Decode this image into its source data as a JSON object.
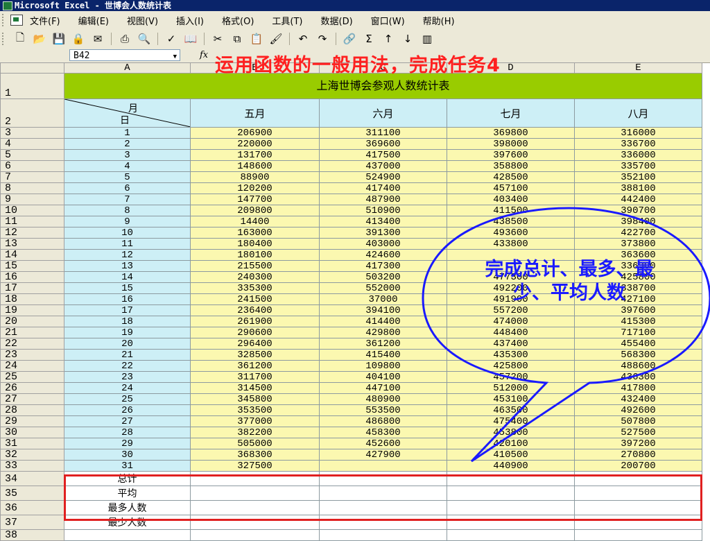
{
  "window": {
    "title": "Microsoft Excel - 世博会人数统计表"
  },
  "menu": {
    "items": [
      "文件(F)",
      "编辑(E)",
      "视图(V)",
      "插入(I)",
      "格式(O)",
      "工具(T)",
      "数据(D)",
      "窗口(W)",
      "帮助(H)"
    ]
  },
  "toolbar": {
    "sum_glyph": "Σ"
  },
  "formula_bar": {
    "name_box": "B42",
    "fx_label": "fx"
  },
  "overlay": {
    "headline": "运用函数的一般用法，完成任务4",
    "callout": "完成总计、最多、最少、平均人数"
  },
  "sheet": {
    "col_headers": [
      "A",
      "B",
      "C",
      "D",
      "E"
    ],
    "title": "上海世博会参观人数统计表",
    "corner_top": "月",
    "corner_bottom": "日",
    "month_headers": [
      "五月",
      "六月",
      "七月",
      "八月"
    ],
    "rows": [
      {
        "rn": "3",
        "day": "1",
        "v": [
          "206900",
          "311100",
          "369800",
          "316000"
        ]
      },
      {
        "rn": "4",
        "day": "2",
        "v": [
          "220000",
          "369600",
          "398000",
          "336700"
        ]
      },
      {
        "rn": "5",
        "day": "3",
        "v": [
          "131700",
          "417500",
          "397600",
          "336000"
        ]
      },
      {
        "rn": "6",
        "day": "4",
        "v": [
          "148600",
          "437000",
          "358800",
          "335700"
        ]
      },
      {
        "rn": "7",
        "day": "5",
        "v": [
          "88900",
          "524900",
          "428500",
          "352100"
        ]
      },
      {
        "rn": "8",
        "day": "6",
        "v": [
          "120200",
          "417400",
          "457100",
          "388100"
        ]
      },
      {
        "rn": "9",
        "day": "7",
        "v": [
          "147700",
          "487900",
          "403400",
          "442400"
        ]
      },
      {
        "rn": "10",
        "day": "8",
        "v": [
          "209800",
          "510900",
          "411500",
          "390700"
        ]
      },
      {
        "rn": "11",
        "day": "9",
        "v": [
          "14400",
          "413400",
          "438500",
          "398400"
        ]
      },
      {
        "rn": "12",
        "day": "10",
        "v": [
          "163000",
          "391300",
          "493600",
          "422700"
        ]
      },
      {
        "rn": "13",
        "day": "11",
        "v": [
          "180400",
          "403000",
          "433800",
          "373800"
        ]
      },
      {
        "rn": "14",
        "day": "12",
        "v": [
          "180100",
          "424600",
          "",
          "363600"
        ]
      },
      {
        "rn": "15",
        "day": "13",
        "v": [
          "215500",
          "417300",
          "",
          "336300"
        ]
      },
      {
        "rn": "16",
        "day": "14",
        "v": [
          "240300",
          "503200",
          "477300",
          "425800"
        ]
      },
      {
        "rn": "17",
        "day": "15",
        "v": [
          "335300",
          "552000",
          "492200",
          "338700"
        ]
      },
      {
        "rn": "18",
        "day": "16",
        "v": [
          "241500",
          "37000",
          "491900",
          "427100"
        ]
      },
      {
        "rn": "19",
        "day": "17",
        "v": [
          "236400",
          "394100",
          "557200",
          "397600"
        ]
      },
      {
        "rn": "20",
        "day": "18",
        "v": [
          "261900",
          "414400",
          "474000",
          "415300"
        ]
      },
      {
        "rn": "21",
        "day": "19",
        "v": [
          "290600",
          "429800",
          "448400",
          "717100"
        ]
      },
      {
        "rn": "22",
        "day": "20",
        "v": [
          "296400",
          "361200",
          "437400",
          "455400"
        ]
      },
      {
        "rn": "23",
        "day": "21",
        "v": [
          "328500",
          "415400",
          "435300",
          "568300"
        ]
      },
      {
        "rn": "24",
        "day": "22",
        "v": [
          "361200",
          "109800",
          "425800",
          "488600"
        ]
      },
      {
        "rn": "25",
        "day": "23",
        "v": [
          "311700",
          "404100",
          "457200",
          "436300"
        ]
      },
      {
        "rn": "26",
        "day": "24",
        "v": [
          "314500",
          "447100",
          "512000",
          "417800"
        ]
      },
      {
        "rn": "27",
        "day": "25",
        "v": [
          "345800",
          "480900",
          "453100",
          "432400"
        ]
      },
      {
        "rn": "28",
        "day": "26",
        "v": [
          "353500",
          "553500",
          "463500",
          "492600"
        ]
      },
      {
        "rn": "29",
        "day": "27",
        "v": [
          "377000",
          "486800",
          "475400",
          "507800"
        ]
      },
      {
        "rn": "30",
        "day": "28",
        "v": [
          "382200",
          "458300",
          "453800",
          "527500"
        ]
      },
      {
        "rn": "31",
        "day": "29",
        "v": [
          "505000",
          "452600",
          "420100",
          "397200"
        ]
      },
      {
        "rn": "32",
        "day": "30",
        "v": [
          "368300",
          "427900",
          "410500",
          "270800"
        ]
      },
      {
        "rn": "33",
        "day": "31",
        "v": [
          "327500",
          "",
          "440900",
          "200700"
        ]
      }
    ],
    "summary_rows": [
      {
        "rn": "34",
        "label": "总计"
      },
      {
        "rn": "35",
        "label": "平均"
      },
      {
        "rn": "36",
        "label": "最多人数"
      },
      {
        "rn": "37",
        "label": "最少人数"
      }
    ],
    "row_numbers": {
      "title_row": "1",
      "header_row": "2",
      "last_row": "38"
    }
  },
  "colors": {
    "title_bg": "#99cc00",
    "day_bg": "#cdeff6",
    "value_bg": "#fbf8b0",
    "highlight": "#e02020",
    "callout": "#1a1aff"
  }
}
